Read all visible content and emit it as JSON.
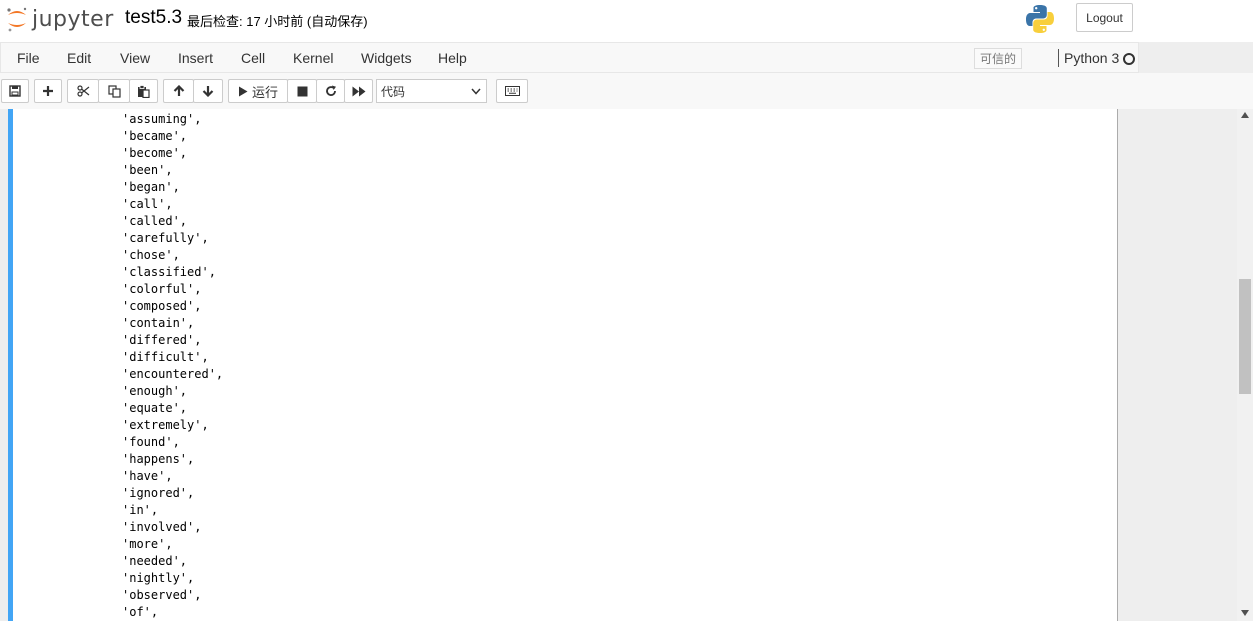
{
  "header": {
    "logo_text": "jupyter",
    "notebook_name": "test5.3",
    "checkpoint": "最后检查: 17 小时前  (自动保存)",
    "logout_label": "Logout"
  },
  "menubar": {
    "items": [
      "File",
      "Edit",
      "View",
      "Insert",
      "Cell",
      "Kernel",
      "Widgets",
      "Help"
    ],
    "trusted": "可信的",
    "kernel": "Python 3"
  },
  "toolbar": {
    "run_label": "运行",
    "cell_type": "代码"
  },
  "output_lines": [
    "'assuming',",
    "'became',",
    "'become',",
    "'been',",
    "'began',",
    "'call',",
    "'called',",
    "'carefully',",
    "'chose',",
    "'classified',",
    "'colorful',",
    "'composed',",
    "'contain',",
    "'differed',",
    "'difficult',",
    "'encountered',",
    "'enough',",
    "'equate',",
    "'extremely',",
    "'found',",
    "'happens',",
    "'have',",
    "'ignored',",
    "'in',",
    "'involved',",
    "'more',",
    "'needed',",
    "'nightly',",
    "'observed',",
    "'of',"
  ],
  "colors": {
    "cell_selected_bar": "#42a5f5",
    "logo_orange": "#f37726"
  }
}
